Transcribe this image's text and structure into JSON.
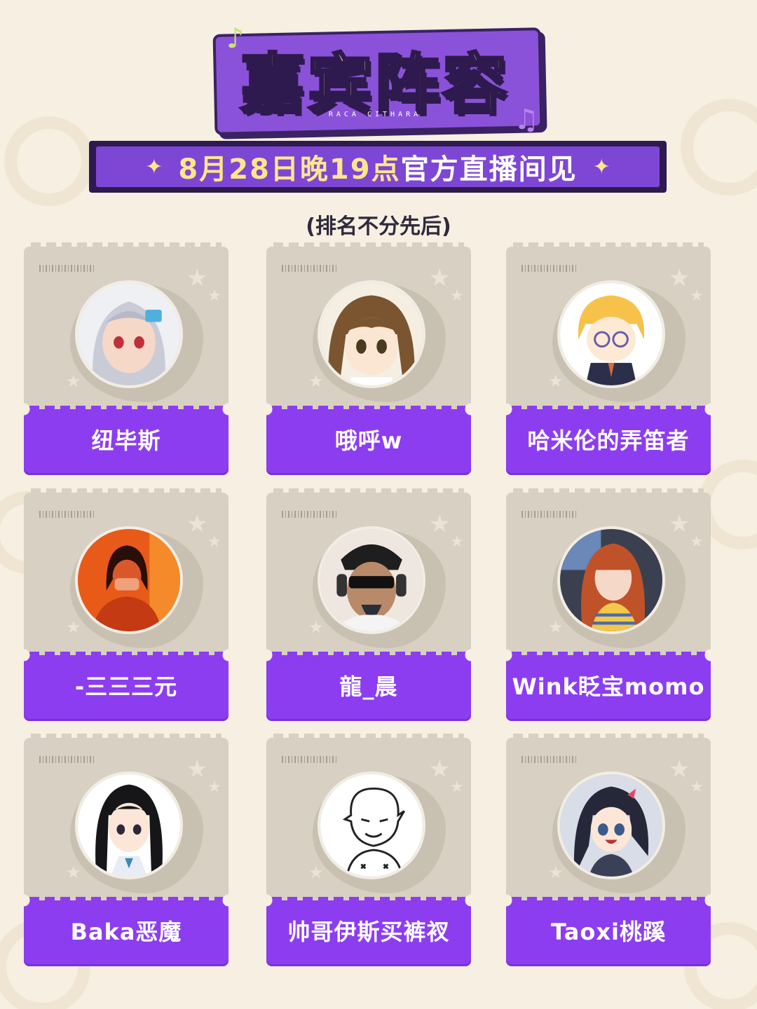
{
  "header": {
    "title": "嘉宾阵容",
    "subtitle": "RACA CITHARA",
    "date_highlight": "8月28日晚19点",
    "date_rest": "官方直播间见",
    "order_note": "(排名不分先后)"
  },
  "colors": {
    "background": "#f6efe2",
    "accent_purple": "#8c3df0",
    "title_yellow": "#fde89a",
    "dark_outline": "#2e1a4e",
    "card_gray": "#d8d0c2"
  },
  "guests": [
    {
      "name": "纽毕斯",
      "avatar": "anime-girl-silver-hair"
    },
    {
      "name": "哦呼w",
      "avatar": "anime-girl-brown-hair"
    },
    {
      "name": "哈米伦的弄笛者",
      "avatar": "chibi-blonde-glasses"
    },
    {
      "name": "-三三三元",
      "avatar": "person-orange-light-mask"
    },
    {
      "name": "龍_晨",
      "avatar": "man-sunglasses-headphones"
    },
    {
      "name": "Wink眨宝momo",
      "avatar": "girl-orange-hair-selfie"
    },
    {
      "name": "Baka恶魔",
      "avatar": "anime-girl-black-hair"
    },
    {
      "name": "帅哥伊斯买裤衩",
      "avatar": "sketch-doodle-boy"
    },
    {
      "name": "Taoxi桃蹊",
      "avatar": "anime-girl-dark-hair-smile"
    }
  ]
}
